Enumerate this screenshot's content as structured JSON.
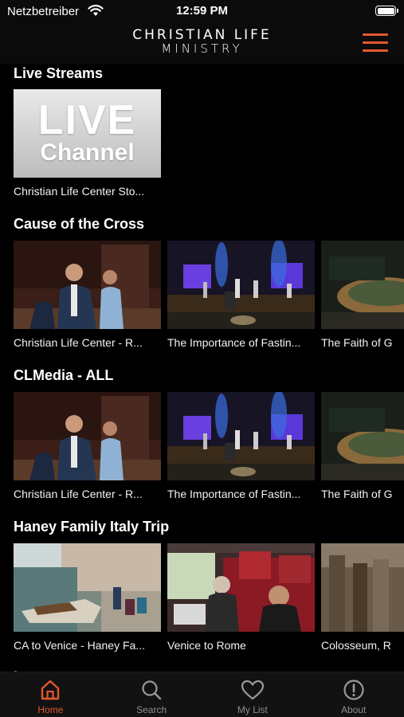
{
  "status_bar": {
    "carrier": "Netzbetreiber",
    "time": "12:59 PM"
  },
  "header": {
    "logo_line1": "CHRISTIAN LIFE",
    "logo_line2": "MINISTRY",
    "accent_color": "#e4572e"
  },
  "sections": [
    {
      "title": "Live Streams",
      "items": [
        {
          "title": "Christian Life Center Sto...",
          "thumb_text_1": "LIVE",
          "thumb_text_2": "Channel"
        }
      ]
    },
    {
      "title": "Cause of the Cross",
      "items": [
        {
          "title": "Christian Life Center - R..."
        },
        {
          "title": "The Importance of Fastin..."
        },
        {
          "title": "The Faith of G"
        }
      ]
    },
    {
      "title": "CLMedia - ALL",
      "items": [
        {
          "title": "Christian Life Center - R..."
        },
        {
          "title": "The Importance of Fastin..."
        },
        {
          "title": "The Faith of G"
        }
      ]
    },
    {
      "title": "Haney Family Italy Trip",
      "items": [
        {
          "title": "CA to Venice - Haney Fa..."
        },
        {
          "title": "Venice to Rome"
        },
        {
          "title": "Colosseum, R"
        }
      ]
    },
    {
      "title": "iTunes"
    }
  ],
  "tabs": [
    {
      "label": "Home",
      "icon": "home-icon",
      "active": true
    },
    {
      "label": "Search",
      "icon": "search-icon"
    },
    {
      "label": "My List",
      "icon": "heart-icon"
    },
    {
      "label": "About",
      "icon": "info-icon"
    }
  ]
}
